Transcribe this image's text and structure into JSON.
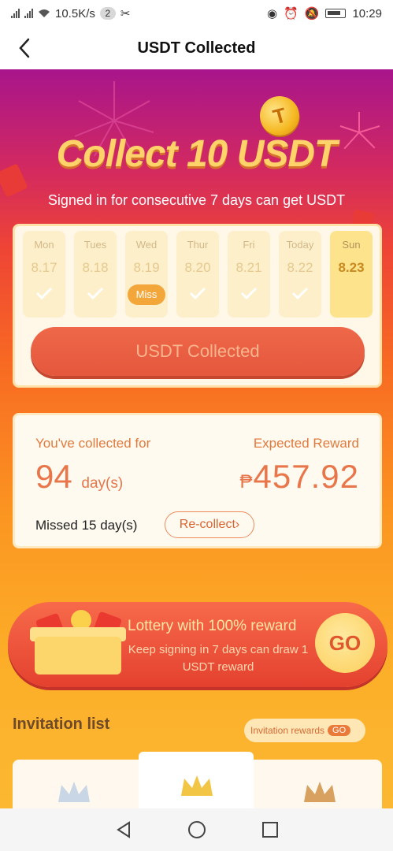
{
  "status_bar": {
    "net_speed": "10.5K/s",
    "notification_count": "2",
    "time": "10:29"
  },
  "nav": {
    "title": "USDT Collected"
  },
  "hero": {
    "title": "Collect 10 USDT",
    "subtitle": "Signed in for consecutive 7 days can get USDT",
    "coin_symbol": "T"
  },
  "signin": {
    "days": [
      {
        "name": "Mon",
        "date": "8.17",
        "status": "checked"
      },
      {
        "name": "Tues",
        "date": "8.18",
        "status": "checked"
      },
      {
        "name": "Wed",
        "date": "8.19",
        "status": "missed",
        "tag": "Miss"
      },
      {
        "name": "Thur",
        "date": "8.20",
        "status": "checked"
      },
      {
        "name": "Fri",
        "date": "8.21",
        "status": "checked"
      },
      {
        "name": "Today",
        "date": "8.22",
        "status": "checked"
      },
      {
        "name": "Sun",
        "date": "8.23",
        "status": "upcoming"
      }
    ],
    "button_label": "USDT Collected"
  },
  "stats": {
    "collected_label": "You've collected for",
    "collected_days": "94",
    "collected_unit": "day(s)",
    "reward_label": "Expected Reward",
    "reward_currency": "₱",
    "reward_amount": "457.92",
    "missed_text": "Missed 15 day(s)",
    "recollect_label": "Re-collect›"
  },
  "lottery": {
    "title": "Lottery with 100% reward",
    "subtitle": "Keep signing in 7 days can draw 1 USDT reward",
    "go_label": "GO"
  },
  "invitation": {
    "title": "Invitation list",
    "rewards_label": "Invitation rewards",
    "rewards_go": "GO"
  },
  "colors": {
    "accent": "#e8764a",
    "button_red": "#e5573d",
    "gold": "#fcd66a"
  }
}
